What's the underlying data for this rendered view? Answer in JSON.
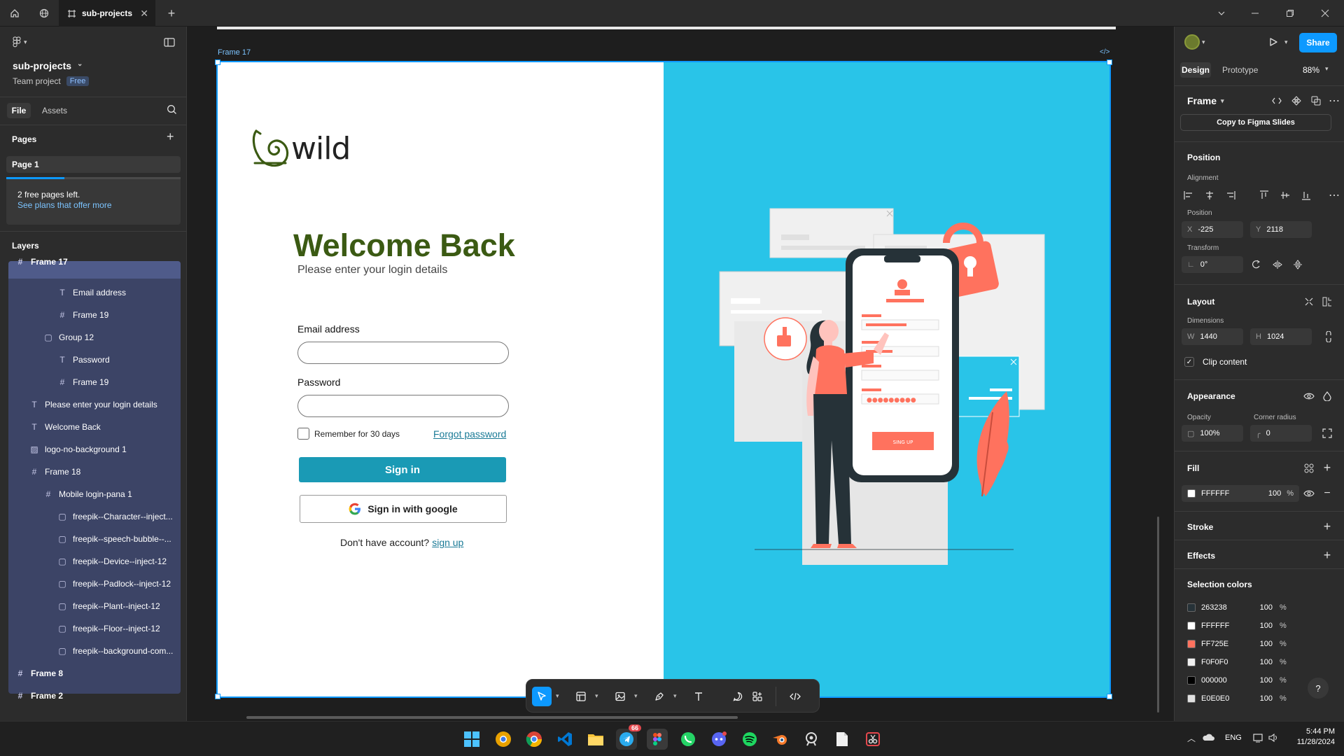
{
  "titlebar": {
    "tab_label": "sub-projects",
    "icons": [
      "home-icon",
      "globe-icon",
      "frame-icon",
      "close-icon",
      "plus-icon",
      "chevron-down-icon",
      "minimize-icon",
      "restore-icon",
      "close-window-icon"
    ]
  },
  "left": {
    "project_name": "sub-projects",
    "project_chevron": "⌄",
    "team_label": "Team project",
    "plan_badge": "Free",
    "tab_file": "File",
    "tab_assets": "Assets",
    "pages_title": "Pages",
    "page_1": "Page 1",
    "free_pages_text": "2 free pages left.",
    "see_plans_link": "See plans that offer more",
    "layers_title": "Layers",
    "layers": [
      {
        "label": "Frame 17",
        "icon": "#"
      },
      {
        "label": "Email address",
        "icon": "T"
      },
      {
        "label": "Frame 19",
        "icon": "#"
      },
      {
        "label": "Group 12",
        "icon": "▢"
      },
      {
        "label": "Password",
        "icon": "T"
      },
      {
        "label": "Frame 19",
        "icon": "#"
      },
      {
        "label": "Please enter your login details",
        "icon": "T"
      },
      {
        "label": "Welcome Back",
        "icon": "T"
      },
      {
        "label": "logo-no-background 1",
        "icon": "▨"
      },
      {
        "label": "Frame 18",
        "icon": "#"
      },
      {
        "label": "Mobile login-pana 1",
        "icon": "#"
      },
      {
        "label": "freepik--Character--inject...",
        "icon": "▢"
      },
      {
        "label": "freepik--speech-bubble--...",
        "icon": "▢"
      },
      {
        "label": "freepik--Device--inject-12",
        "icon": "▢"
      },
      {
        "label": "freepik--Padlock--inject-12",
        "icon": "▢"
      },
      {
        "label": "freepik--Plant--inject-12",
        "icon": "▢"
      },
      {
        "label": "freepik--Floor--inject-12",
        "icon": "▢"
      },
      {
        "label": "freepik--background-com...",
        "icon": "▢"
      },
      {
        "label": "Frame 8",
        "icon": "#"
      },
      {
        "label": "Frame 2",
        "icon": "#"
      }
    ]
  },
  "canvas": {
    "frame_label": "Frame 17",
    "code_icon": "</>"
  },
  "design": {
    "logo_text": "wild",
    "heading": "Welcome Back",
    "subheading": "Please enter your login details",
    "email_label": "Email address",
    "password_label": "Password",
    "remember_label": "Remember for 30 days",
    "forgot_link": "Forgot password",
    "sign_in_button": "Sign in",
    "google_button": "Sign in with google",
    "no_account_text": "Don't have account?",
    "signup_link": "sign up",
    "phone_signup_button": "SING UP",
    "colors": {
      "brand_green": "#3b5a13",
      "panel_blue": "#29c4e8",
      "button_teal": "#1a9ab5",
      "coral": "#ff725e",
      "dark": "#263238"
    }
  },
  "right": {
    "tab_design": "Design",
    "tab_prototype": "Prototype",
    "zoom": "88%",
    "share_button": "Share",
    "frame_dropdown": "Frame",
    "copy_slides_button": "Copy to Figma Slides",
    "position_title": "Position",
    "alignment_label": "Alignment",
    "position_label": "Position",
    "x_label": "X",
    "x_value": "-225",
    "y_label": "Y",
    "y_value": "2118",
    "transform_label": "Transform",
    "rotation_value": "0°",
    "layout_title": "Layout",
    "dimensions_label": "Dimensions",
    "w_label": "W",
    "w_value": "1440",
    "h_label": "H",
    "h_value": "1024",
    "clip_content_label": "Clip content",
    "appearance_title": "Appearance",
    "opacity_label": "Opacity",
    "opacity_value": "100%",
    "corner_radius_label": "Corner radius",
    "corner_radius_value": "0",
    "fill_title": "Fill",
    "fill_hex": "FFFFFF",
    "fill_opacity": "100",
    "percent": "%",
    "stroke_title": "Stroke",
    "effects_title": "Effects",
    "selection_colors_title": "Selection colors",
    "selection_colors": [
      {
        "hex": "263238",
        "swatch": "#263238",
        "opacity": "100"
      },
      {
        "hex": "FFFFFF",
        "swatch": "#ffffff",
        "opacity": "100"
      },
      {
        "hex": "FF725E",
        "swatch": "#ff725e",
        "opacity": "100"
      },
      {
        "hex": "F0F0F0",
        "swatch": "#f0f0f0",
        "opacity": "100"
      },
      {
        "hex": "000000",
        "swatch": "#000000",
        "opacity": "100"
      },
      {
        "hex": "E0E0E0",
        "swatch": "#e0e0e0",
        "opacity": "100"
      }
    ],
    "help_button": "?"
  },
  "taskbar": {
    "telegram_badge": "66",
    "language": "ENG",
    "time": "5:44 PM",
    "date": "11/28/2024"
  }
}
